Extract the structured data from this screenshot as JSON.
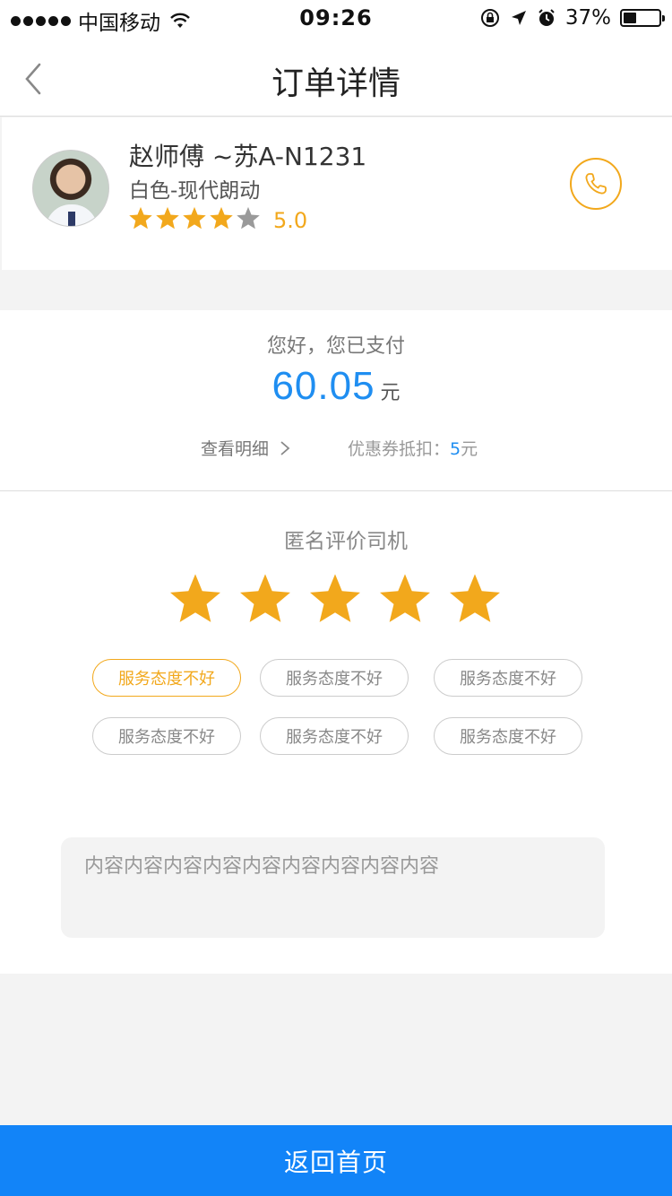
{
  "status_bar": {
    "carrier": "中国移动",
    "time": "09:26",
    "battery": "37%"
  },
  "nav": {
    "title": "订单详情"
  },
  "driver": {
    "name": "赵师傅 ~苏A-N1231",
    "car": "白色-现代朗动",
    "rating_filled": 4,
    "rating_total": 5,
    "score": "5.0"
  },
  "payment": {
    "greeting": "您好，您已支付",
    "amount": "60.05",
    "unit": "元",
    "detail_label": "查看明细",
    "coupon_label": "优惠券抵扣：",
    "coupon_value": "5",
    "coupon_unit": "元"
  },
  "rating": {
    "title": "匿名评价司机",
    "stars_selected": 5,
    "tags": [
      {
        "label": "服务态度不好",
        "selected": true
      },
      {
        "label": "服务态度不好",
        "selected": false
      },
      {
        "label": "服务态度不好",
        "selected": false
      },
      {
        "label": "服务态度不好",
        "selected": false
      },
      {
        "label": "服务态度不好",
        "selected": false
      },
      {
        "label": "服务态度不好",
        "selected": false
      }
    ],
    "comment": "内容内容内容内容内容内容内容内容内容"
  },
  "footer": {
    "button_label": "返回首页"
  },
  "colors": {
    "accent_blue": "#1284f8",
    "amount_blue": "#1f8ef1",
    "star_yellow": "#f2a81c",
    "star_gray": "#9a9a9a"
  }
}
